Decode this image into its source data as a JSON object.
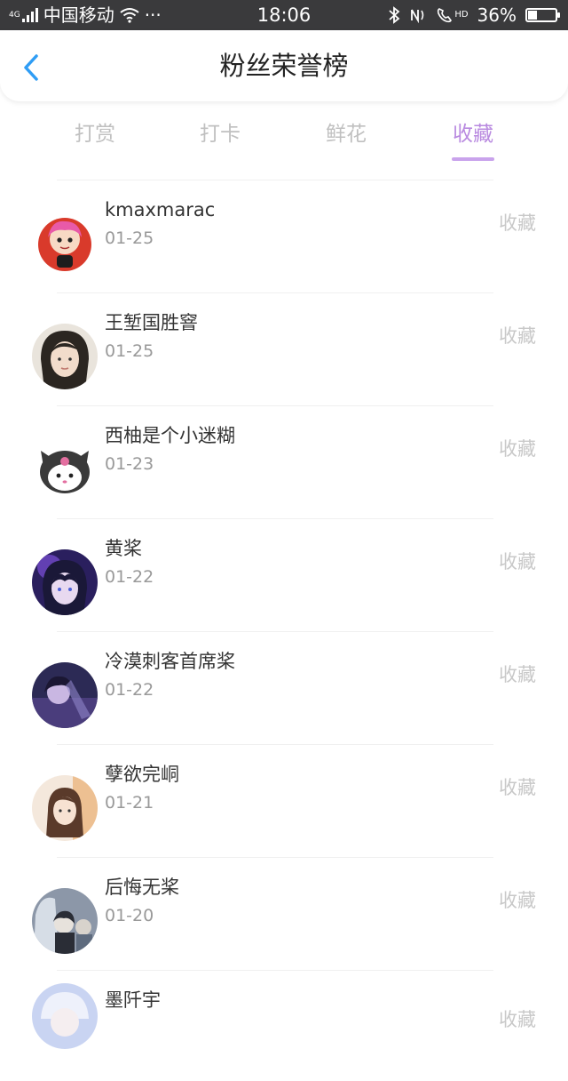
{
  "status_bar": {
    "network": "4G",
    "carrier": "中国移动",
    "time": "18:06",
    "hd_label": "HD",
    "battery": "36%",
    "battery_level": 0.36
  },
  "header": {
    "title": "粉丝荣誉榜"
  },
  "tabs": [
    {
      "label": "打赏",
      "active": false
    },
    {
      "label": "打卡",
      "active": false
    },
    {
      "label": "鲜花",
      "active": false
    },
    {
      "label": "收藏",
      "active": true
    }
  ],
  "fans": [
    {
      "name": "kmaxmarac",
      "date": "01-25",
      "action": "收藏"
    },
    {
      "name": "王堑国胜窨",
      "date": "01-25",
      "action": "收藏"
    },
    {
      "name": "西柚是个小迷糊",
      "date": "01-23",
      "action": "收藏"
    },
    {
      "name": "黄桨",
      "date": "01-22",
      "action": "收藏"
    },
    {
      "name": "冷漠刺客首席桨",
      "date": "01-22",
      "action": "收藏"
    },
    {
      "name": "孽欲完峒",
      "date": "01-21",
      "action": "收藏"
    },
    {
      "name": "后悔无桨",
      "date": "01-20",
      "action": "收藏"
    },
    {
      "name": "墨阡宇",
      "date": "",
      "action": "收藏"
    }
  ],
  "colors": {
    "accent": "#b98ae0",
    "underline": "#c9a3ec",
    "status_bar": "#3a3a3c"
  }
}
